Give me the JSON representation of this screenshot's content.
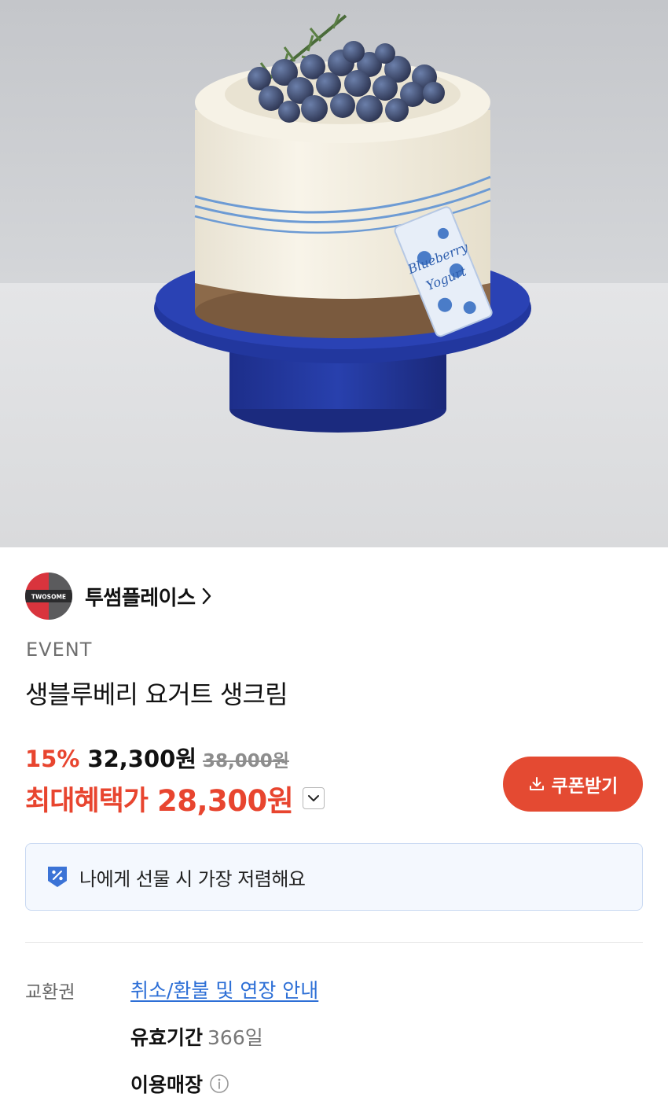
{
  "product_image": {
    "tag_text_line1": "Blueberry",
    "tag_text_line2": "Yogurt"
  },
  "brand": {
    "logo_text": "TWOSOME",
    "name": "투썸플레이스"
  },
  "product": {
    "badge": "EVENT",
    "title": "생블루베리 요거트 생크림"
  },
  "price": {
    "discount": "15%",
    "sale_price": "32,300원",
    "original_price": "38,000원",
    "max_benefit_label": "최대혜택가",
    "max_benefit_price": "28,300원"
  },
  "coupon_button": {
    "label": "쿠폰받기"
  },
  "banner": {
    "text": "나에게 선물 시 가장 저렴해요"
  },
  "details": {
    "label": "교환권",
    "refund_link": "취소/환불 및 연장 안내",
    "validity_label": "유효기간",
    "validity_value": "366일",
    "store_label": "이용매장"
  },
  "colors": {
    "accent": "#e44a32",
    "link": "#2d6fd6",
    "banner_bg": "#f4f8fe",
    "banner_border": "#c9d9f2"
  }
}
